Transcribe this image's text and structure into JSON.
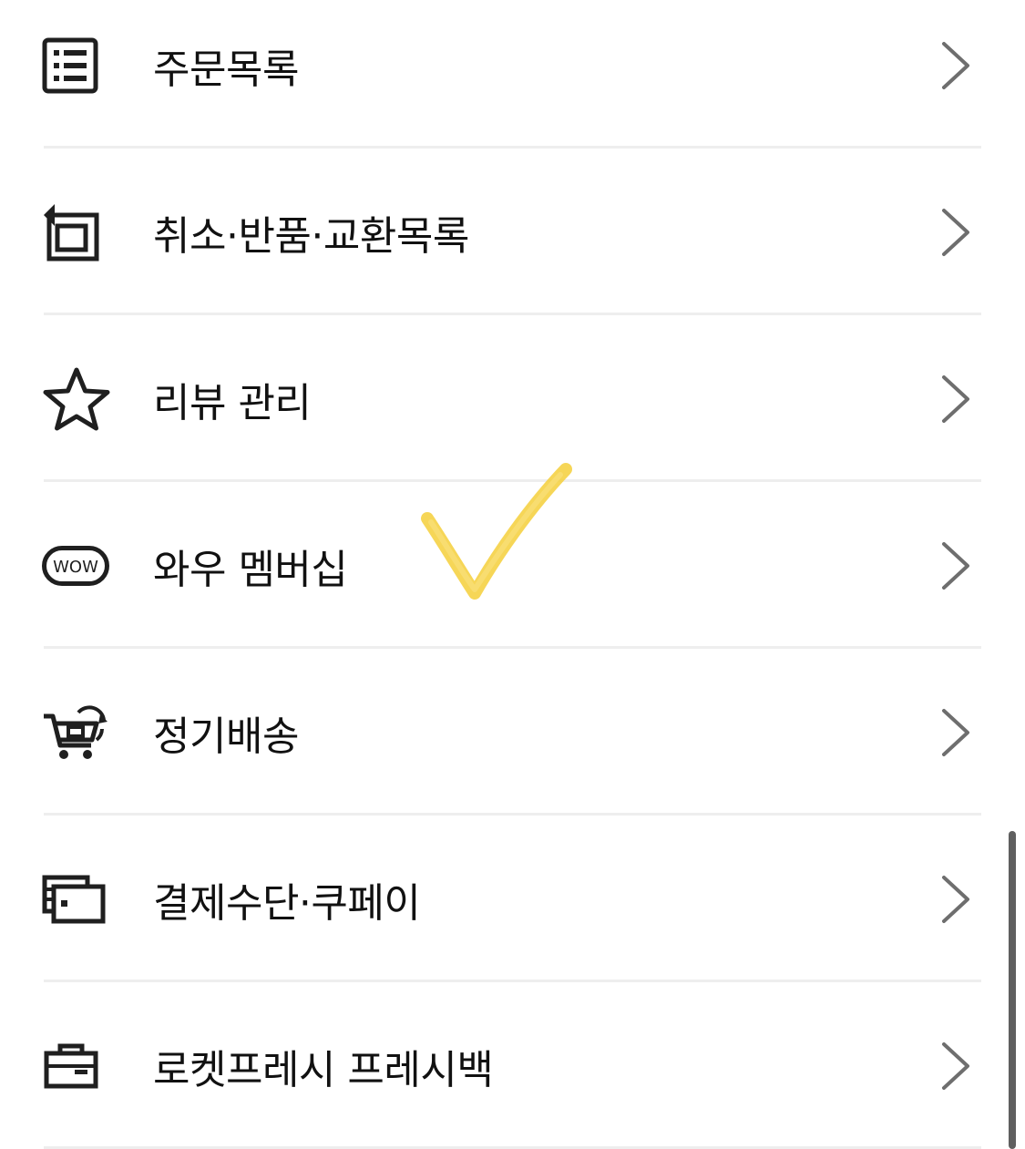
{
  "menu": {
    "items": [
      {
        "label": "주문목록",
        "icon": "order-list-icon"
      },
      {
        "label": "취소·반품·교환목록",
        "icon": "return-box-icon"
      },
      {
        "label": "리뷰 관리",
        "icon": "star-icon"
      },
      {
        "label": "와우 멤버십",
        "icon": "wow-badge-icon",
        "badge_text": "WOW"
      },
      {
        "label": "정기배송",
        "icon": "subscription-cart-icon"
      },
      {
        "label": "결제수단·쿠페이",
        "icon": "payment-card-icon"
      },
      {
        "label": "로켓프레시 프레시백",
        "icon": "fresh-bag-icon"
      }
    ]
  },
  "colors": {
    "text": "#111111",
    "icon": "#1f1f1f",
    "chevron": "#6e6e6e",
    "divider": "#eeeeee",
    "annotation": "#f5cf3a",
    "scrollbar": "#5f5f5f"
  }
}
